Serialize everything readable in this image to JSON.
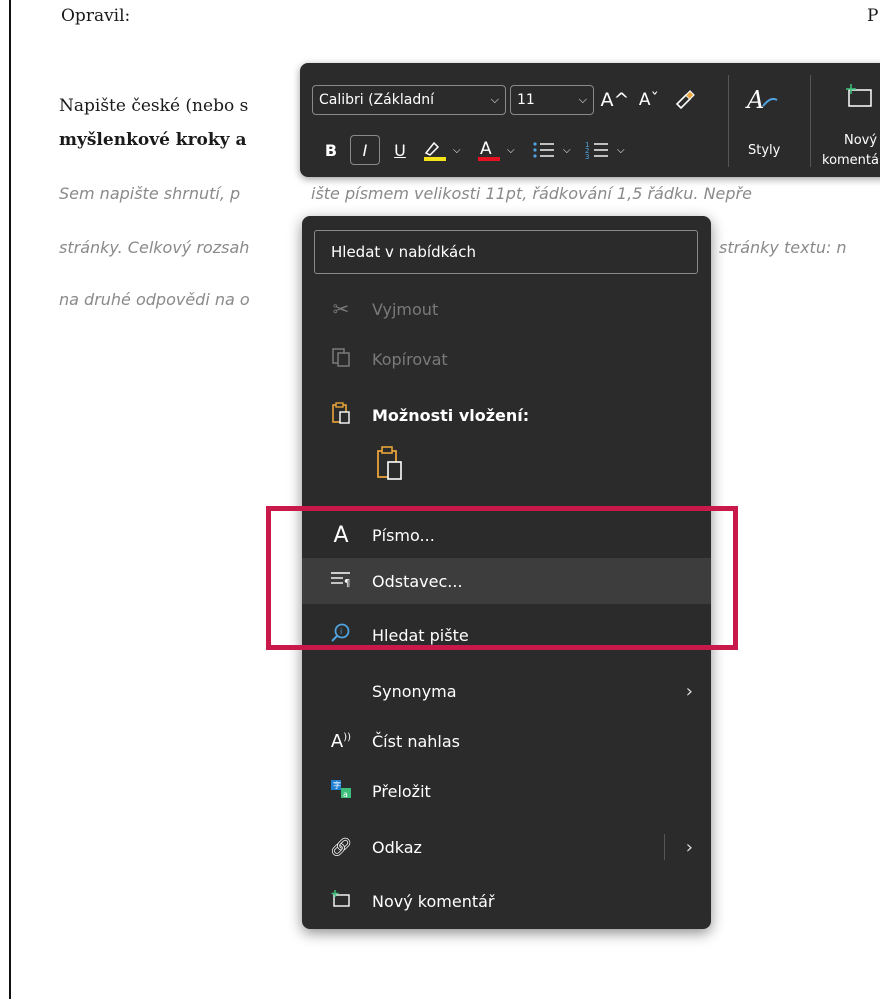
{
  "document": {
    "top_left": "Opravil:",
    "top_right": "P",
    "line1_normal": "Napište české (nebo s",
    "line2_bold": "myšlenkové kroky a",
    "italic1_left": "Sem napište shrnutí, p",
    "italic1_right": "ište písmem velikosti 11pt, řádkování 1,5 řádku. Nepře",
    "italic2_left": "stránky. Celkový rozsah",
    "italic2_right": "stránky textu: n",
    "italic3_left": "na druhé odpovědi na o"
  },
  "toolbar": {
    "font_name": "Calibri (Základní",
    "font_size": "11",
    "grow_icon": "A^",
    "shrink_icon": "Aˇ",
    "format_painter_icon": "brush-icon",
    "bold": "B",
    "italic": "I",
    "underline": "U",
    "styles_label": "Styly",
    "comment_label_1": "Nový",
    "comment_label_2": "komentář"
  },
  "menu": {
    "search_placeholder": "Hledat v nabídkách",
    "cut": "Vyjmout",
    "copy": "Kopírovat",
    "paste_options": "Možnosti vložení:",
    "font": "Písmo...",
    "paragraph": "Odstavec...",
    "search_text": "Hledat pište",
    "synonyms": "Synonyma",
    "read_aloud": "Číst nahlas",
    "translate": "Přeložit",
    "link": "Odkaz",
    "new_comment": "Nový komentář"
  },
  "colors": {
    "highlight_border": "#c8194a",
    "menu_bg": "#2b2b2b",
    "paste_icon": "#e8a33a",
    "highlighter_yellow": "#f5e31a",
    "font_color_red": "#e81123"
  }
}
